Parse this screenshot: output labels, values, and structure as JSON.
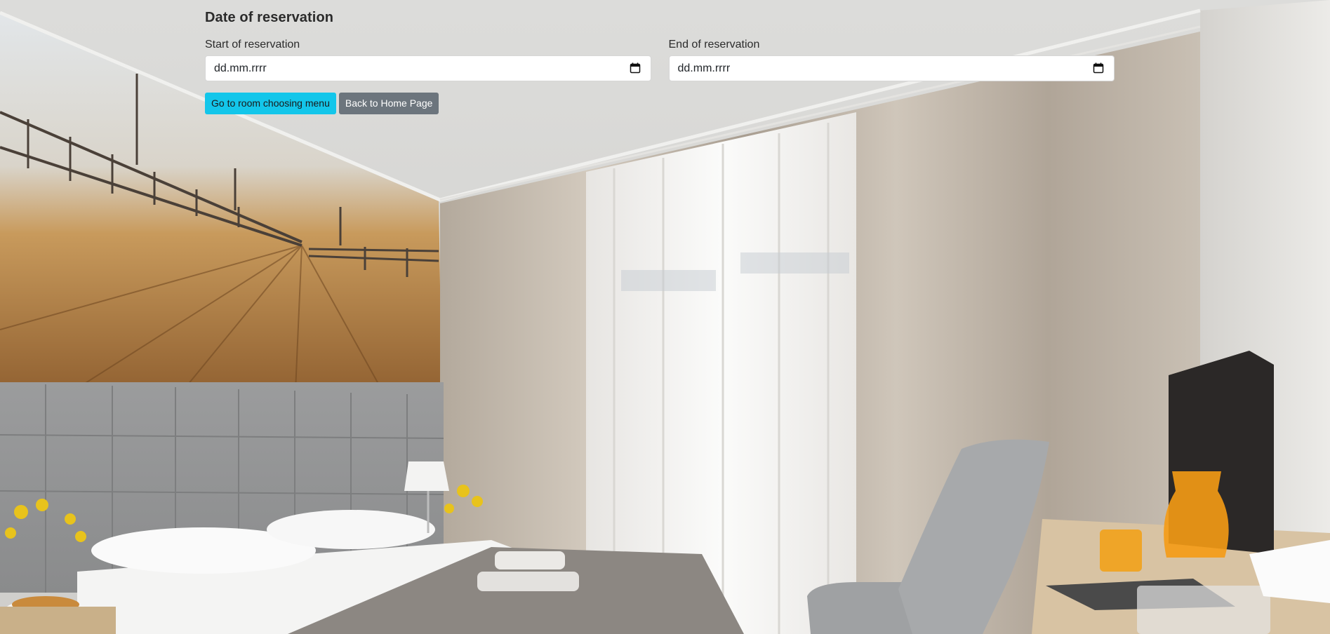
{
  "page": {
    "title": "Date of reservation"
  },
  "form": {
    "start": {
      "label": "Start of reservation",
      "value": "dd.mm.rrrr"
    },
    "end": {
      "label": "End of reservation",
      "value": "dd.mm.rrrr"
    }
  },
  "buttons": {
    "room_menu": "Go to room choosing menu",
    "home": "Back to Home Page"
  },
  "colors": {
    "primary_button": "#13c6ea",
    "secondary_button": "#6c757d"
  },
  "icons": {
    "date_picker": "calendar-icon"
  }
}
